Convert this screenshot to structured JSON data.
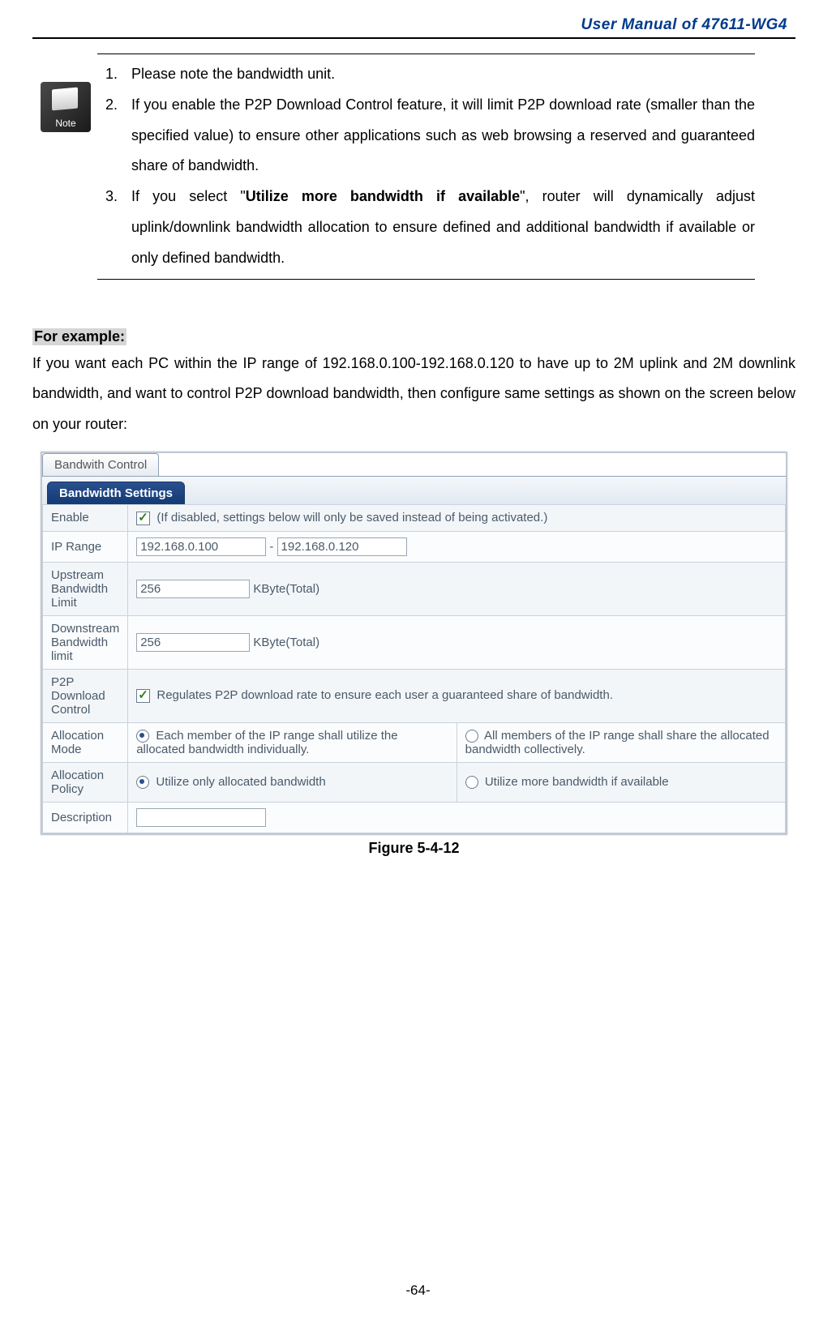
{
  "header": {
    "title": "User Manual of 47611-WG4"
  },
  "note": {
    "items": [
      "Please note the bandwidth unit.",
      "If you enable the P2P Download Control feature, it will limit P2P download rate (smaller than the specified value) to ensure other applications such as web browsing a reserved and guaranteed share of bandwidth.",
      "If you select \"<b>Utilize more bandwidth if available</b>\", router will dynamically adjust uplink/downlink bandwidth allocation to ensure defined and additional bandwidth if available or only defined bandwidth."
    ],
    "icon_label": "Note"
  },
  "example": {
    "label": "For example:",
    "text": "If you want each PC within the IP range of 192.168.0.100-192.168.0.120 to have up to 2M uplink and 2M downlink bandwidth, and want to control P2P download bandwidth, then configure same settings as shown on the screen below on your router:"
  },
  "figure": {
    "tab": "Bandwith Control",
    "subtab": "Bandwidth Settings",
    "rows": {
      "enable_label": "Enable",
      "enable_text": "(If disabled, settings below will only be saved instead of being activated.)",
      "ip_label": "IP Range",
      "ip_start": "192.168.0.100",
      "ip_end": "192.168.0.120",
      "up_label": "Upstream Bandwidth Limit",
      "up_val": "256",
      "up_unit": "KByte(Total)",
      "down_label": "Downstream Bandwidth limit",
      "down_val": "256",
      "down_unit": "KByte(Total)",
      "p2p_label": "P2P Download Control",
      "p2p_text": "Regulates P2P download rate to ensure each user a guaranteed share of bandwidth.",
      "mode_label": "Allocation Mode",
      "mode_opt1": "Each member of the IP range shall utilize the allocated bandwidth individually.",
      "mode_opt2": "All members of the IP range shall share the allocated bandwidth collectively.",
      "policy_label": "Allocation Policy",
      "policy_opt1": "Utilize only allocated bandwidth",
      "policy_opt2": "Utilize more bandwidth if available",
      "desc_label": "Description",
      "desc_val": ""
    },
    "caption": "Figure 5-4-12"
  },
  "page_number": "-64-"
}
